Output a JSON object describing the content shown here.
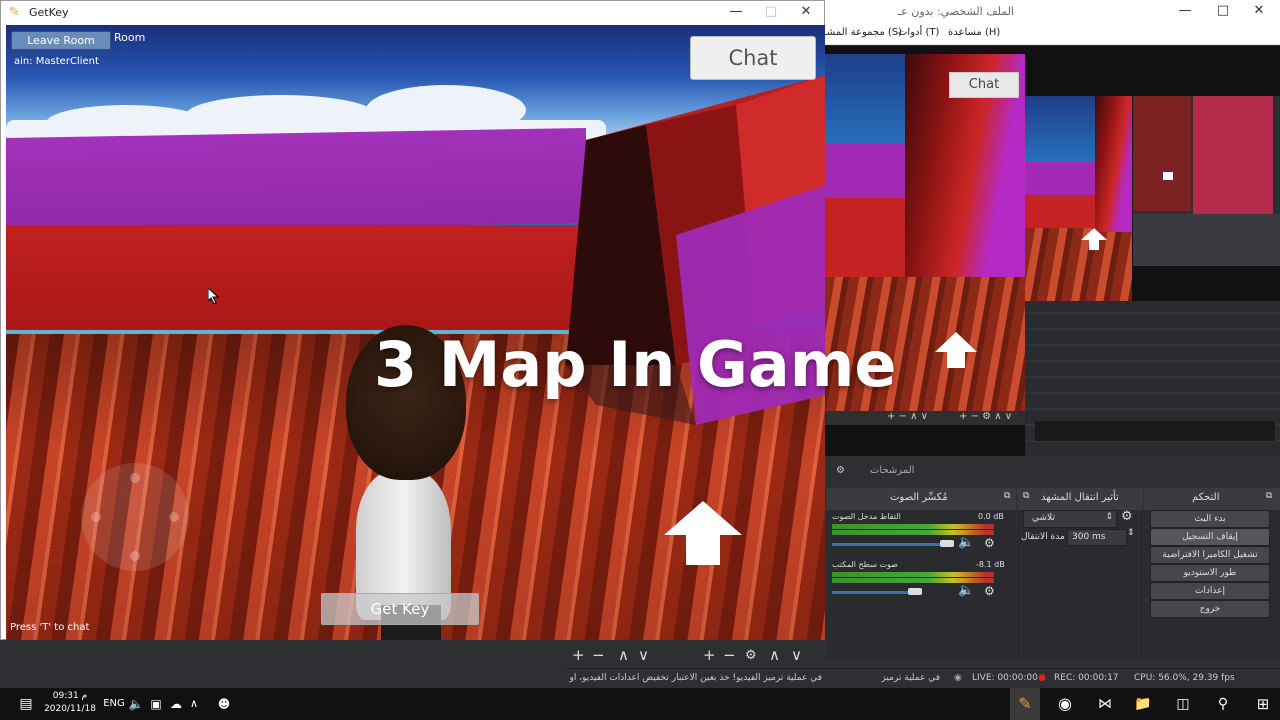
{
  "game_window": {
    "title": "GetKey",
    "leave_room_label": "Leave Room",
    "room_label": "Room",
    "master_label": "ain: MasterClient",
    "chat_label": "Chat",
    "getkey_label": "Get Key",
    "press_t_label": "Press 'T' to chat",
    "overlay_title": "3 Map In Game"
  },
  "obs": {
    "title": "الملف الشخصي: بدون عـ",
    "menu": [
      "مجموعة المشـ (S)",
      "أدوات (T)",
      "مساعدة (H)"
    ],
    "nested_chat_label": "Chat",
    "scenes_label": "المرشحات",
    "mixer": {
      "title": "مُكسِّر الصوت",
      "channels": [
        {
          "name": "التقاط مدخل الصوت",
          "db": "0.0 dB"
        },
        {
          "name": "صوت سطح المكتب",
          "db": "-8.1 dB"
        }
      ]
    },
    "transition": {
      "title": "تأثير انتقال المشهد",
      "type": "تلاشي",
      "duration_label": "مدة الانتقال",
      "duration_value": "300 ms"
    },
    "controls": {
      "title": "التحكم",
      "buttons": [
        "بدء البث",
        "إيقاف التسجيل",
        "تشغيل الكاميرا الافتراضية",
        "طور الاستوديو",
        "إعدادات",
        "خروج"
      ]
    },
    "status": {
      "message": "في عملية ترميز الفيديو! خذ بعين الاعتبار تخفيض اعدادات الفيديو، او استخدم اعدادات ترميز اسرع",
      "live": "LIVE: 00:00:00",
      "rec": "REC: 00:00:17",
      "cpu": "CPU: 56.0%, 29.39 fps"
    }
  },
  "taskbar": {
    "time": "09:31 م",
    "date": "2020/11/18",
    "lang": "ENG"
  }
}
